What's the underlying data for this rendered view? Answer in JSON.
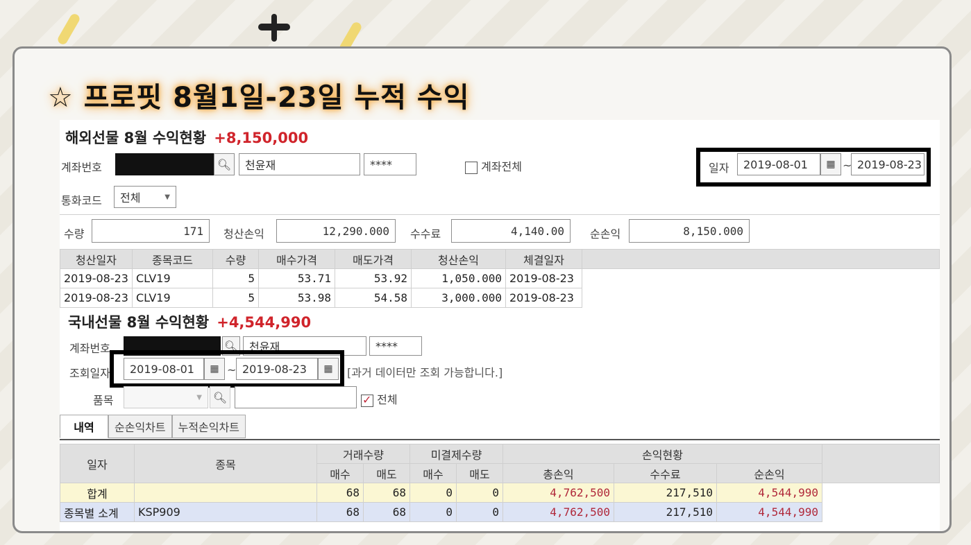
{
  "headline": "☆ 프로핏  8월1일-23일 누적 수익",
  "overseas": {
    "title": "해외선물 8월 수익현황",
    "profit": "+8,150,000",
    "account_label": "계좌번호",
    "owner_name": "천윤재",
    "password_mask": "****",
    "all_accounts_label": "계좌전체",
    "date_label": "일자",
    "date_from": "2019-08-01",
    "date_sep": "~",
    "date_to": "2019-08-23",
    "currency_label": "통화코드",
    "currency_value": "전체",
    "summary": {
      "qty_label": "수량",
      "qty": "171",
      "settle_label": "청산손익",
      "settle": "12,290.000",
      "fee_label": "수수료",
      "fee": "4,140.00",
      "net_label": "순손익",
      "net": "8,150.000"
    },
    "columns": [
      "청산일자",
      "종목코드",
      "수량",
      "매수가격",
      "매도가격",
      "청산손익",
      "체결일자"
    ],
    "rows": [
      [
        "2019-08-23",
        "CLV19",
        "5",
        "53.71",
        "53.92",
        "1,050.000",
        "2019-08-23"
      ],
      [
        "2019-08-23",
        "CLV19",
        "5",
        "53.98",
        "54.58",
        "3,000.000",
        "2019-08-23"
      ]
    ]
  },
  "domestic": {
    "title": "국내선물 8월 수익현황",
    "profit": "+4,544,990",
    "account_label": "계좌번호",
    "owner_name": "천윤재",
    "password_mask": "****",
    "query_date_label": "조회일자",
    "date_from": "2019-08-01",
    "date_sep": "~",
    "date_to": "2019-08-23",
    "note": "[과거 데이터만 조회 가능합니다.]",
    "item_label": "품목",
    "all_label": "전체",
    "tabs": [
      "내역",
      "순손익차트",
      "누적손익차트"
    ],
    "headers": {
      "date": "일자",
      "item": "종목",
      "trade_qty": "거래수량",
      "open_qty": "미결제수량",
      "pnl_status": "손익현황",
      "buy": "매수",
      "sell": "매도",
      "gross": "총손익",
      "fee": "수수료",
      "net": "순손익"
    },
    "rows": [
      {
        "label": "합계",
        "item": "",
        "buy": "68",
        "sell": "68",
        "open_buy": "0",
        "open_sell": "0",
        "gross": "4,762,500",
        "fee": "217,510",
        "net": "4,544,990"
      },
      {
        "label": "종목별 소계",
        "item": "KSP909",
        "buy": "68",
        "sell": "68",
        "open_buy": "0",
        "open_sell": "0",
        "gross": "4,762,500",
        "fee": "217,510",
        "net": "4,544,990"
      }
    ]
  },
  "colors": {
    "profit_red": "#d0242b",
    "total_row": "#fbf7d3",
    "subtotal_row": "#dde4f5",
    "glow": "#f6a94a"
  },
  "icons": [
    "search-icon",
    "calendar-icon",
    "dropdown-arrow-icon",
    "checkbox-icon"
  ]
}
